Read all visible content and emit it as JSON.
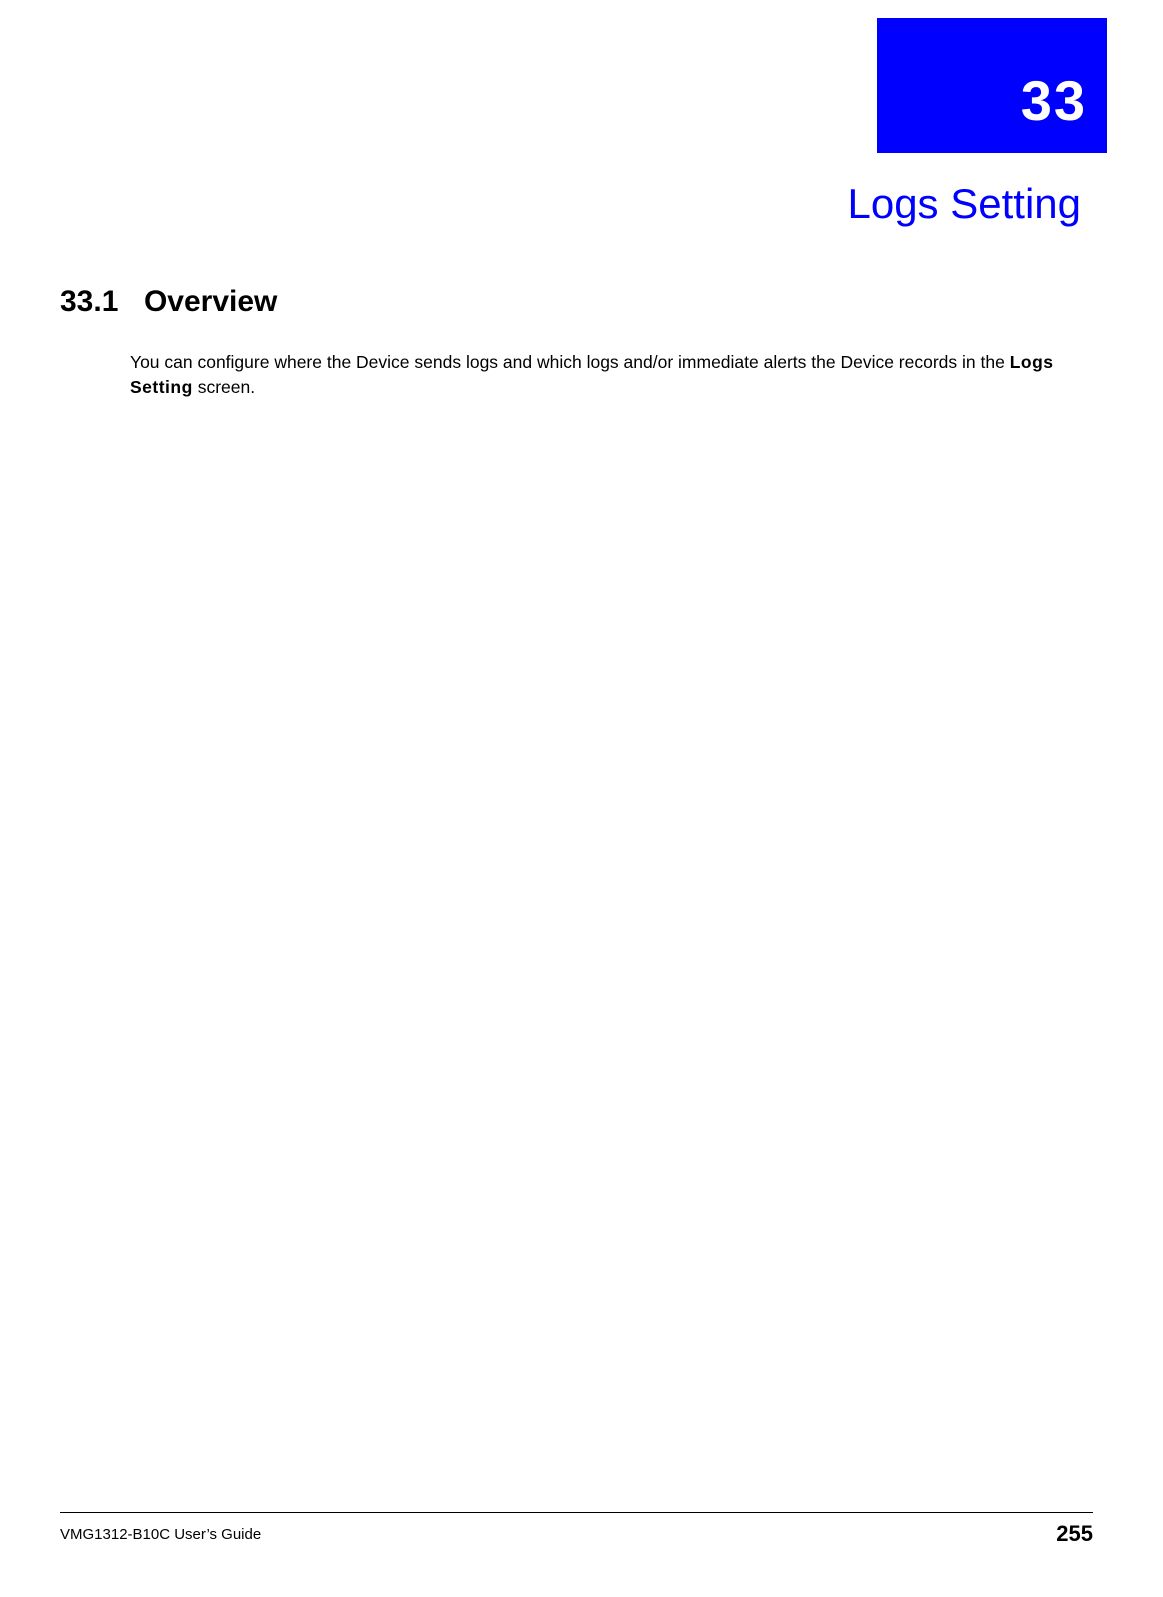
{
  "chapter": {
    "number": "33",
    "title": "Logs Setting"
  },
  "section": {
    "number": "33.1",
    "heading": "Overview"
  },
  "body": {
    "text_before": "You can configure where the Device sends logs and which logs and/or immediate alerts the Device records in the ",
    "bold_ref": "Logs Setting",
    "text_after": " screen."
  },
  "footer": {
    "guide_name": "VMG1312-B10C User’s Guide",
    "page_number": "255"
  }
}
